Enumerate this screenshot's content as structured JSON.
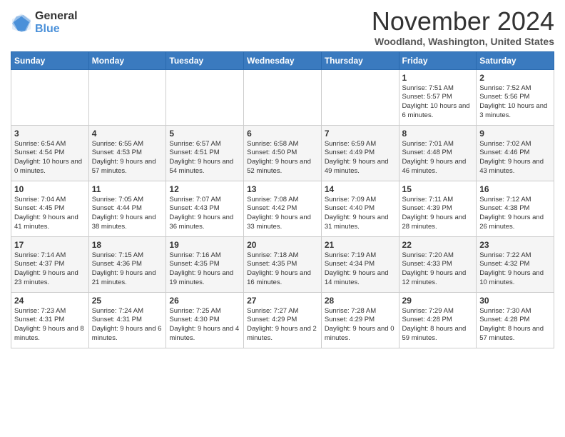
{
  "logo": {
    "general": "General",
    "blue": "Blue"
  },
  "title": "November 2024",
  "location": "Woodland, Washington, United States",
  "weekdays": [
    "Sunday",
    "Monday",
    "Tuesday",
    "Wednesday",
    "Thursday",
    "Friday",
    "Saturday"
  ],
  "weeks": [
    [
      {
        "day": "",
        "info": ""
      },
      {
        "day": "",
        "info": ""
      },
      {
        "day": "",
        "info": ""
      },
      {
        "day": "",
        "info": ""
      },
      {
        "day": "",
        "info": ""
      },
      {
        "day": "1",
        "info": "Sunrise: 7:51 AM\nSunset: 5:57 PM\nDaylight: 10 hours and 6 minutes."
      },
      {
        "day": "2",
        "info": "Sunrise: 7:52 AM\nSunset: 5:56 PM\nDaylight: 10 hours and 3 minutes."
      }
    ],
    [
      {
        "day": "3",
        "info": "Sunrise: 6:54 AM\nSunset: 4:54 PM\nDaylight: 10 hours and 0 minutes."
      },
      {
        "day": "4",
        "info": "Sunrise: 6:55 AM\nSunset: 4:53 PM\nDaylight: 9 hours and 57 minutes."
      },
      {
        "day": "5",
        "info": "Sunrise: 6:57 AM\nSunset: 4:51 PM\nDaylight: 9 hours and 54 minutes."
      },
      {
        "day": "6",
        "info": "Sunrise: 6:58 AM\nSunset: 4:50 PM\nDaylight: 9 hours and 52 minutes."
      },
      {
        "day": "7",
        "info": "Sunrise: 6:59 AM\nSunset: 4:49 PM\nDaylight: 9 hours and 49 minutes."
      },
      {
        "day": "8",
        "info": "Sunrise: 7:01 AM\nSunset: 4:48 PM\nDaylight: 9 hours and 46 minutes."
      },
      {
        "day": "9",
        "info": "Sunrise: 7:02 AM\nSunset: 4:46 PM\nDaylight: 9 hours and 43 minutes."
      }
    ],
    [
      {
        "day": "10",
        "info": "Sunrise: 7:04 AM\nSunset: 4:45 PM\nDaylight: 9 hours and 41 minutes."
      },
      {
        "day": "11",
        "info": "Sunrise: 7:05 AM\nSunset: 4:44 PM\nDaylight: 9 hours and 38 minutes."
      },
      {
        "day": "12",
        "info": "Sunrise: 7:07 AM\nSunset: 4:43 PM\nDaylight: 9 hours and 36 minutes."
      },
      {
        "day": "13",
        "info": "Sunrise: 7:08 AM\nSunset: 4:42 PM\nDaylight: 9 hours and 33 minutes."
      },
      {
        "day": "14",
        "info": "Sunrise: 7:09 AM\nSunset: 4:40 PM\nDaylight: 9 hours and 31 minutes."
      },
      {
        "day": "15",
        "info": "Sunrise: 7:11 AM\nSunset: 4:39 PM\nDaylight: 9 hours and 28 minutes."
      },
      {
        "day": "16",
        "info": "Sunrise: 7:12 AM\nSunset: 4:38 PM\nDaylight: 9 hours and 26 minutes."
      }
    ],
    [
      {
        "day": "17",
        "info": "Sunrise: 7:14 AM\nSunset: 4:37 PM\nDaylight: 9 hours and 23 minutes."
      },
      {
        "day": "18",
        "info": "Sunrise: 7:15 AM\nSunset: 4:36 PM\nDaylight: 9 hours and 21 minutes."
      },
      {
        "day": "19",
        "info": "Sunrise: 7:16 AM\nSunset: 4:35 PM\nDaylight: 9 hours and 19 minutes."
      },
      {
        "day": "20",
        "info": "Sunrise: 7:18 AM\nSunset: 4:35 PM\nDaylight: 9 hours and 16 minutes."
      },
      {
        "day": "21",
        "info": "Sunrise: 7:19 AM\nSunset: 4:34 PM\nDaylight: 9 hours and 14 minutes."
      },
      {
        "day": "22",
        "info": "Sunrise: 7:20 AM\nSunset: 4:33 PM\nDaylight: 9 hours and 12 minutes."
      },
      {
        "day": "23",
        "info": "Sunrise: 7:22 AM\nSunset: 4:32 PM\nDaylight: 9 hours and 10 minutes."
      }
    ],
    [
      {
        "day": "24",
        "info": "Sunrise: 7:23 AM\nSunset: 4:31 PM\nDaylight: 9 hours and 8 minutes."
      },
      {
        "day": "25",
        "info": "Sunrise: 7:24 AM\nSunset: 4:31 PM\nDaylight: 9 hours and 6 minutes."
      },
      {
        "day": "26",
        "info": "Sunrise: 7:25 AM\nSunset: 4:30 PM\nDaylight: 9 hours and 4 minutes."
      },
      {
        "day": "27",
        "info": "Sunrise: 7:27 AM\nSunset: 4:29 PM\nDaylight: 9 hours and 2 minutes."
      },
      {
        "day": "28",
        "info": "Sunrise: 7:28 AM\nSunset: 4:29 PM\nDaylight: 9 hours and 0 minutes."
      },
      {
        "day": "29",
        "info": "Sunrise: 7:29 AM\nSunset: 4:28 PM\nDaylight: 8 hours and 59 minutes."
      },
      {
        "day": "30",
        "info": "Sunrise: 7:30 AM\nSunset: 4:28 PM\nDaylight: 8 hours and 57 minutes."
      }
    ]
  ]
}
